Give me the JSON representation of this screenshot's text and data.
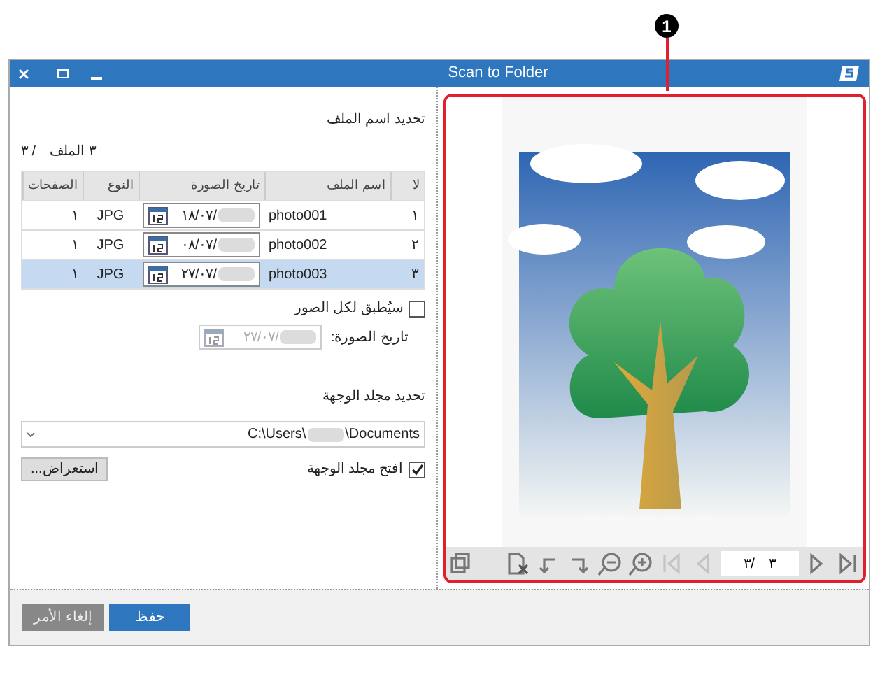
{
  "callout": "1",
  "window": {
    "title": "Scan to Folder"
  },
  "file_name_section": {
    "heading": "تحديد اسم الملف",
    "count_label": "٣ الملف",
    "count_total": "/ ٣"
  },
  "table": {
    "columns": [
      "لا",
      "اسم الملف",
      "تاريخ الصورة",
      "النوع",
      "الصفحات"
    ],
    "rows": [
      {
        "number": "١",
        "file_name": "photo001",
        "date": "١٨/٠٧/",
        "type": "JPG",
        "pages": "١",
        "selected": false
      },
      {
        "number": "٢",
        "file_name": "photo002",
        "date": "٠٨/٠٧/",
        "type": "JPG",
        "pages": "١",
        "selected": false
      },
      {
        "number": "٣",
        "file_name": "photo003",
        "date": "٢٧/٠٧/",
        "type": "JPG",
        "pages": "١",
        "selected": true
      }
    ]
  },
  "apply_all": {
    "label": "سيُطبق لكل الصور",
    "checked": false
  },
  "image_date": {
    "label": "تاريخ الصورة:",
    "value": "٢٧/٠٧/",
    "disabled": true
  },
  "folder_section": {
    "heading": "تحديد مجلد الوجهة",
    "path_start": "C:\\Users\\",
    "path_end": "\\Documents",
    "browse": "استعراض...",
    "open_folder": {
      "label": "افتح مجلد الوجهة",
      "checked": true
    }
  },
  "preview": {
    "page_current": "٣",
    "page_total": "/٣"
  },
  "buttons": {
    "cancel": "إلغاء الأمر",
    "save": "حفظ"
  }
}
